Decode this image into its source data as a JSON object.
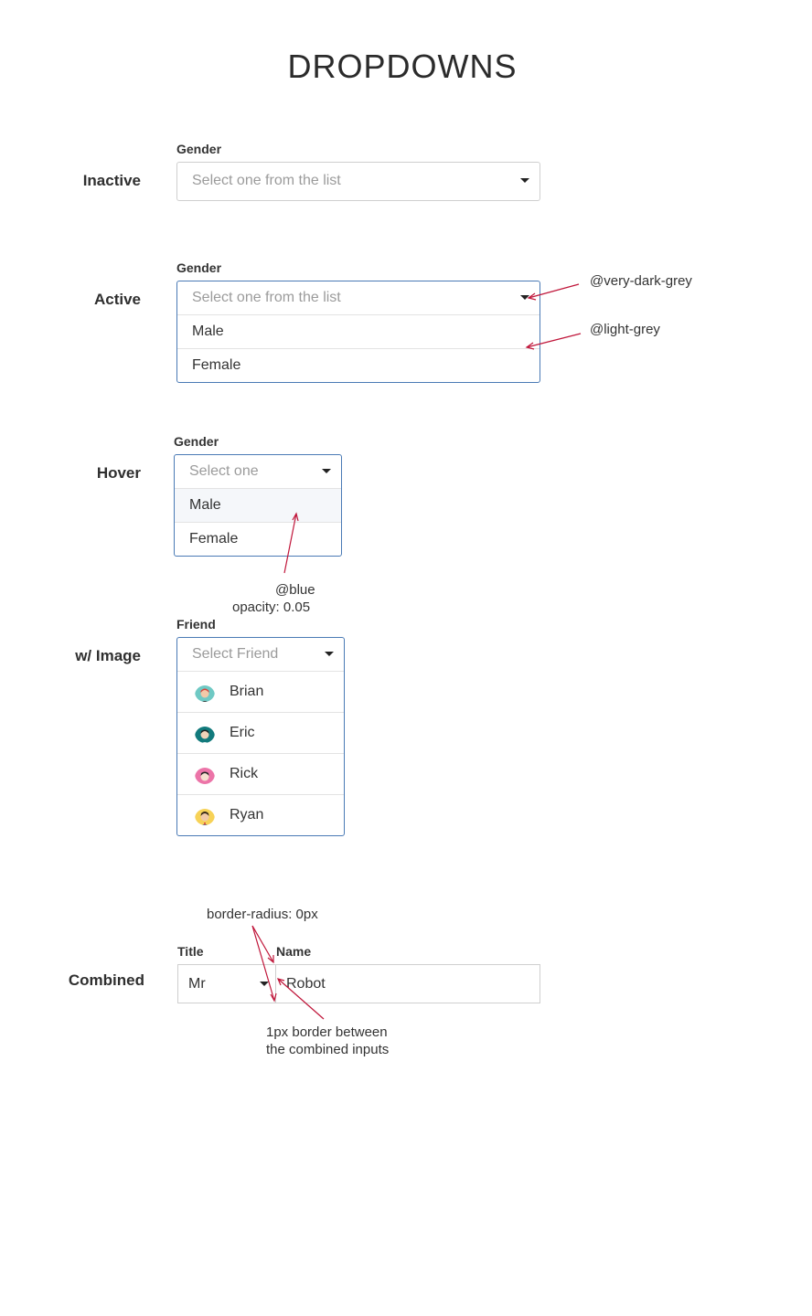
{
  "page": {
    "title": "DROPDOWNS"
  },
  "inactive": {
    "row_label": "Inactive",
    "field_label": "Gender",
    "placeholder": "Select one from the list"
  },
  "active": {
    "row_label": "Active",
    "field_label": "Gender",
    "placeholder": "Select one from the list",
    "options": [
      "Male",
      "Female"
    ],
    "notes": {
      "caret_color": "@very-dark-grey",
      "divider_color": "@light-grey"
    }
  },
  "hover": {
    "row_label": "Hover",
    "field_label": "Gender",
    "placeholder": "Select one",
    "options": [
      "Male",
      "Female"
    ],
    "note_color": "@blue",
    "note_opacity": "opacity: 0.05"
  },
  "with_image": {
    "row_label": "w/ Image",
    "field_label": "Friend",
    "placeholder": "Select Friend",
    "options": [
      {
        "name": "Brian",
        "avatar": "avatar-brian"
      },
      {
        "name": "Eric",
        "avatar": "avatar-eric"
      },
      {
        "name": "Rick",
        "avatar": "avatar-rick"
      },
      {
        "name": "Ryan",
        "avatar": "avatar-ryan"
      }
    ]
  },
  "combined": {
    "row_label": "Combined",
    "title_label": "Title",
    "title_value": "Mr",
    "name_label": "Name",
    "name_value": "Robot",
    "note_radius": "border-radius: 0px",
    "note_border_line1": "1px border between",
    "note_border_line2": "the combined inputs"
  },
  "colors": {
    "active_border": "#4a7ab5",
    "annotation": "#c0163a",
    "hover_bg": "#f5f7fa"
  }
}
